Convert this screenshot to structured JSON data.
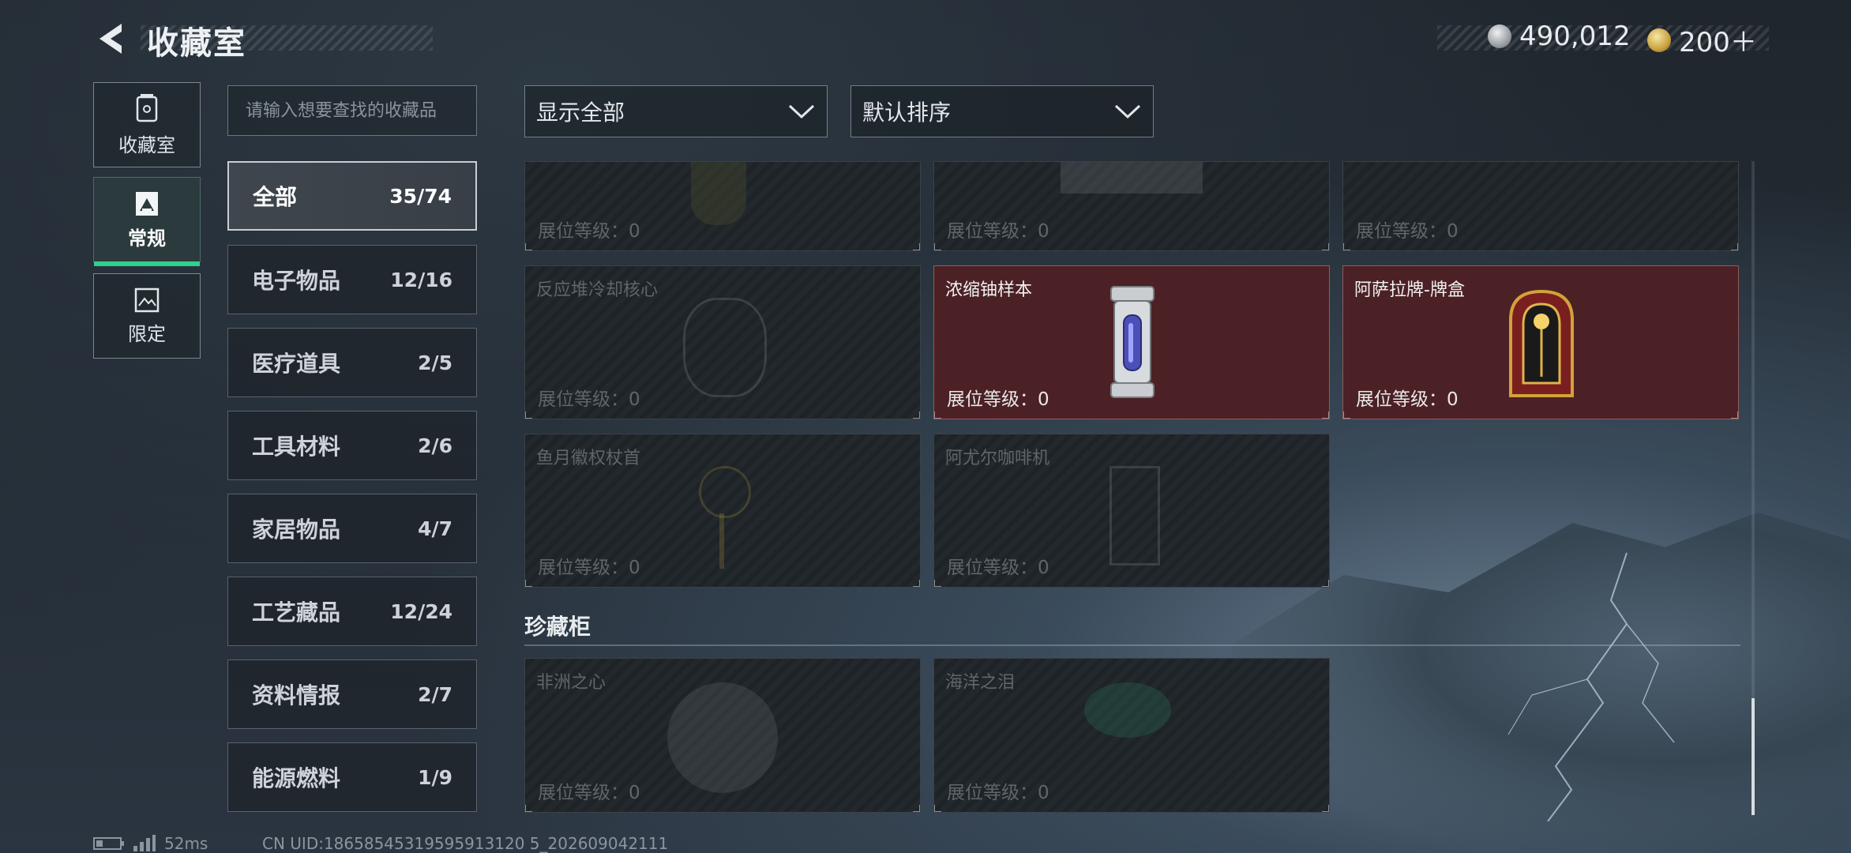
{
  "header": {
    "title": "收藏室",
    "currency": [
      {
        "icon": "silver-coin-icon",
        "value": "490,012"
      },
      {
        "icon": "gold-triangle-coin-icon",
        "value": "200＋"
      }
    ]
  },
  "nav": [
    {
      "label": "收藏室",
      "icon": "collection-jar-icon",
      "active": false
    },
    {
      "label": "常规",
      "icon": "regular-frame-icon",
      "active": true
    },
    {
      "label": "限定",
      "icon": "limited-frame-icon",
      "active": false
    }
  ],
  "search": {
    "placeholder": "请输入想要查找的收藏品"
  },
  "categories": [
    {
      "name": "全部",
      "count": "35/74",
      "active": true
    },
    {
      "name": "电子物品",
      "count": "12/16"
    },
    {
      "name": "医疗道具",
      "count": "2/5"
    },
    {
      "name": "工具材料",
      "count": "2/6"
    },
    {
      "name": "家居物品",
      "count": "4/7"
    },
    {
      "name": "工艺藏品",
      "count": "12/24"
    },
    {
      "name": "资料情报",
      "count": "2/7"
    },
    {
      "name": "能源燃料",
      "count": "1/9"
    }
  ],
  "filters": {
    "show": "显示全部",
    "sort": "默认排序"
  },
  "items": [
    {
      "name": "",
      "level": "展位等级：0",
      "owned": false
    },
    {
      "name": "",
      "level": "展位等级：0",
      "owned": false
    },
    {
      "name": "",
      "level": "展位等级：0",
      "owned": false
    },
    {
      "name": "反应堆冷却核心",
      "level": "展位等级：0",
      "owned": false
    },
    {
      "name": "浓缩铀样本",
      "level": "展位等级：0",
      "owned": true,
      "icon": "uranium-canister-icon"
    },
    {
      "name": "阿萨拉牌-牌盒",
      "level": "展位等级：0",
      "owned": true,
      "icon": "card-box-icon"
    },
    {
      "name": "鱼月徽权杖首",
      "level": "展位等级：0",
      "owned": false
    },
    {
      "name": "阿尤尔咖啡机",
      "level": "展位等级：0",
      "owned": false
    }
  ],
  "treasure": {
    "title": "珍藏柜",
    "items": [
      {
        "name": "非洲之心",
        "level": "展位等级：0",
        "owned": false
      },
      {
        "name": "海洋之泪",
        "level": "展位等级：0",
        "owned": false
      }
    ]
  },
  "status": {
    "ping": "52ms",
    "uid": "CN UID:18658545319595913120 5_202609042111"
  },
  "colors": {
    "accent_green": "#2fd18d",
    "owned_card": "#4c2125"
  }
}
